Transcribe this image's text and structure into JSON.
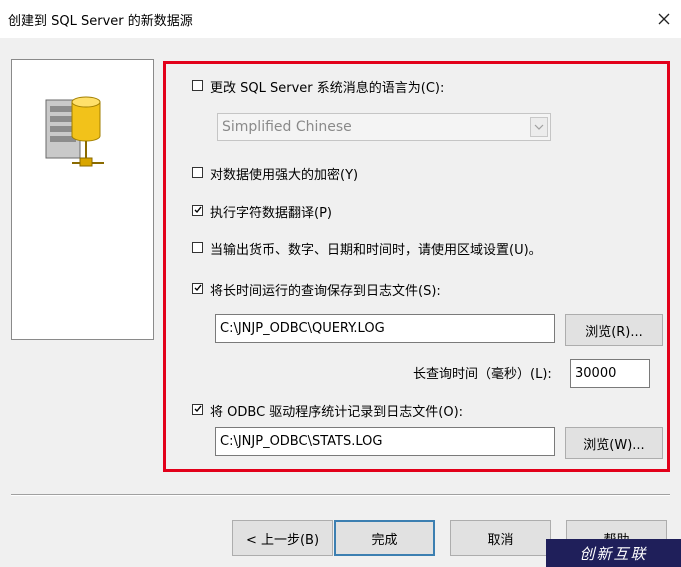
{
  "window": {
    "title": "创建到 SQL Server 的新数据源"
  },
  "options": {
    "change_language": {
      "label": "更改 SQL Server 系统消息的语言为(C):",
      "checked": false
    },
    "language_select": {
      "value": "Simplified Chinese"
    },
    "strong_encryption": {
      "label": "对数据使用强大的加密(Y)",
      "checked": false
    },
    "char_translation": {
      "label": "执行字符数据翻译(P)",
      "checked": true
    },
    "regional_settings": {
      "label": "当输出货币、数字、日期和时间时，请使用区域设置(U)。",
      "checked": false
    },
    "save_long_queries": {
      "label": "将长时间运行的查询保存到日志文件(S):",
      "checked": true
    },
    "query_log_path": {
      "value": "C:\\JNJP_ODBC\\QUERY.LOG"
    },
    "browse_query": {
      "label": "浏览(R)..."
    },
    "long_query_time": {
      "label": "长查询时间（毫秒）(L):",
      "value": "30000"
    },
    "log_odbc_stats": {
      "label": "将 ODBC 驱动程序统计记录到日志文件(O):",
      "checked": true
    },
    "stats_log_path": {
      "value": "C:\\JNJP_ODBC\\STATS.LOG"
    },
    "browse_stats": {
      "label": "浏览(W)..."
    }
  },
  "footer": {
    "back": "< 上一步(B)",
    "finish": "完成",
    "cancel": "取消",
    "help": "帮助"
  },
  "watermark": {
    "text": "创新互联"
  },
  "colors": {
    "highlight_frame": "#e2001a",
    "dialog_bg": "#f0f0f0"
  },
  "icons": [
    "close-icon",
    "database-server-icon",
    "checkbox-check-icon",
    "dropdown-arrow-icon"
  ]
}
